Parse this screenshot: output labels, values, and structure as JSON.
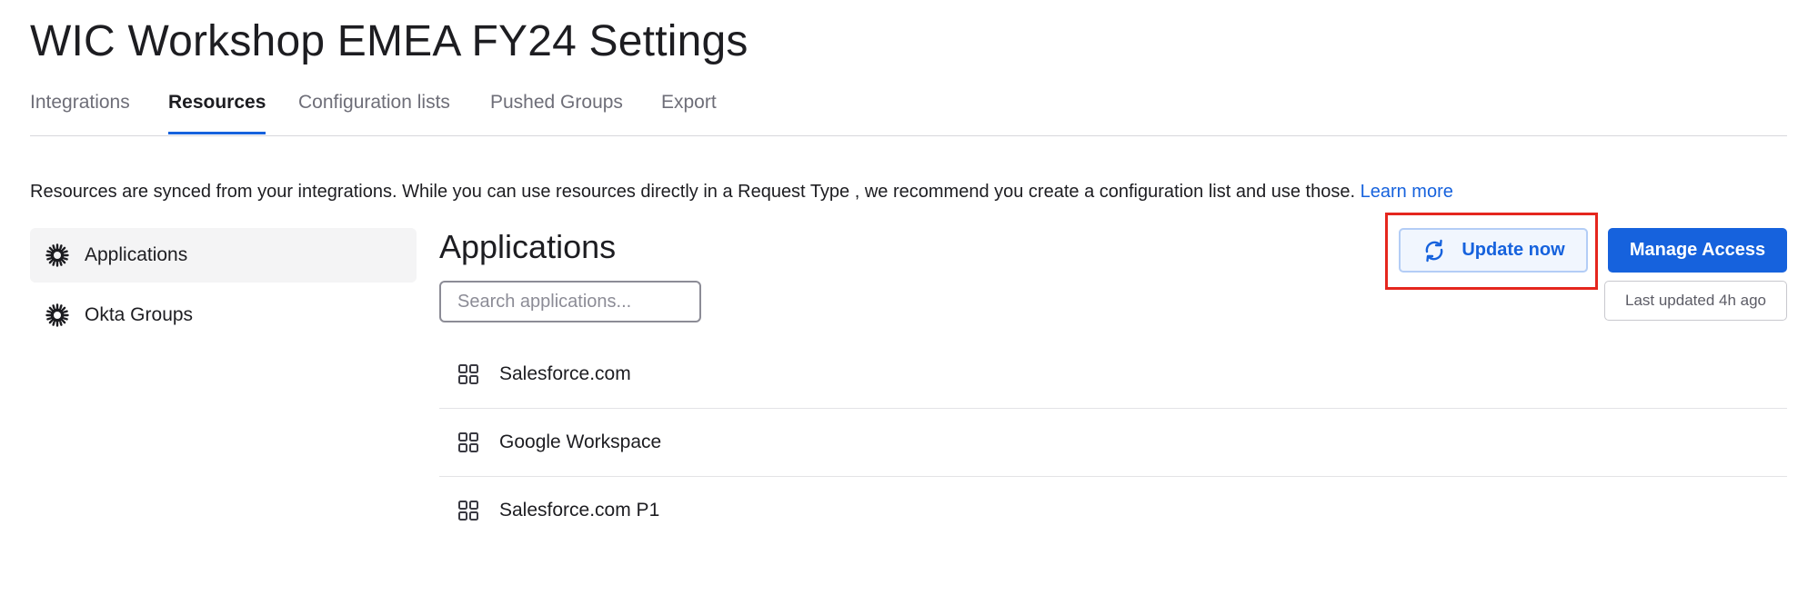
{
  "header": {
    "title": "WIC Workshop EMEA FY24 Settings"
  },
  "tabs": [
    {
      "label": "Integrations",
      "active": false
    },
    {
      "label": "Resources",
      "active": true
    },
    {
      "label": "Configuration lists",
      "active": false
    },
    {
      "label": "Pushed Groups",
      "active": false
    },
    {
      "label": "Export",
      "active": false
    }
  ],
  "description": {
    "text": "Resources are synced from your integrations. While you can use resources directly in a Request Type , we recommend you create a configuration list and use those.",
    "link_label": "Learn more"
  },
  "sidebar": {
    "items": [
      {
        "label": "Applications",
        "icon": "okta-sunburst-icon",
        "selected": true
      },
      {
        "label": "Okta Groups",
        "icon": "okta-sunburst-icon",
        "selected": false
      }
    ]
  },
  "main": {
    "section_title": "Applications",
    "search": {
      "placeholder": "Search applications...",
      "value": ""
    },
    "applications": [
      {
        "name": "Salesforce.com",
        "icon": "app-grid-icon"
      },
      {
        "name": "Google Workspace",
        "icon": "app-grid-icon"
      },
      {
        "name": "Salesforce.com P1",
        "icon": "app-grid-icon"
      }
    ]
  },
  "actions": {
    "update_label": "Update now",
    "update_icon": "sync-icon",
    "manage_label": "Manage Access",
    "last_updated": "Last updated 4h ago"
  },
  "colors": {
    "accent": "#1662dd",
    "highlight": "#e5261e",
    "text": "#1d1d21",
    "muted": "#6e6e78"
  }
}
